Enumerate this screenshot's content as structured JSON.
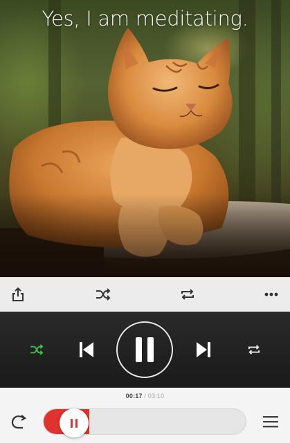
{
  "artwork": {
    "caption": "Yes, I am meditating.",
    "image": "orange-cat-eyes-closed-photo"
  },
  "toolbar": {
    "share_icon": "share-icon",
    "shuffle_icon": "shuffle-icon",
    "repeat_icon": "repeat-icon",
    "more_icon": "more-icon"
  },
  "transport": {
    "shuffle_color": "#3fbf4a",
    "shuffle_icon": "shuffle-icon",
    "previous_icon": "previous-icon",
    "pause_icon": "pause-icon",
    "next_icon": "next-icon",
    "repeat_icon": "repeat-icon"
  },
  "progress": {
    "elapsed": "00:17",
    "separator": "/",
    "total": "03:10",
    "fraction": 0.089,
    "accent": "#e0332f"
  },
  "bottom": {
    "replay_icon": "replay-icon",
    "queue_icon": "queue-list-icon"
  }
}
